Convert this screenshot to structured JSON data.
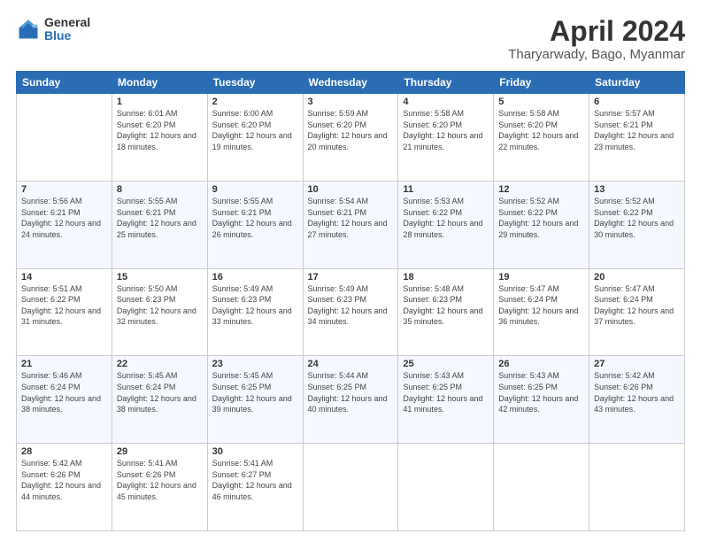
{
  "logo": {
    "general": "General",
    "blue": "Blue"
  },
  "title": "April 2024",
  "subtitle": "Tharyarwady, Bago, Myanmar",
  "headers": [
    "Sunday",
    "Monday",
    "Tuesday",
    "Wednesday",
    "Thursday",
    "Friday",
    "Saturday"
  ],
  "weeks": [
    [
      {
        "day": "",
        "sunrise": "",
        "sunset": "",
        "daylight": ""
      },
      {
        "day": "1",
        "sunrise": "Sunrise: 6:01 AM",
        "sunset": "Sunset: 6:20 PM",
        "daylight": "Daylight: 12 hours and 18 minutes."
      },
      {
        "day": "2",
        "sunrise": "Sunrise: 6:00 AM",
        "sunset": "Sunset: 6:20 PM",
        "daylight": "Daylight: 12 hours and 19 minutes."
      },
      {
        "day": "3",
        "sunrise": "Sunrise: 5:59 AM",
        "sunset": "Sunset: 6:20 PM",
        "daylight": "Daylight: 12 hours and 20 minutes."
      },
      {
        "day": "4",
        "sunrise": "Sunrise: 5:58 AM",
        "sunset": "Sunset: 6:20 PM",
        "daylight": "Daylight: 12 hours and 21 minutes."
      },
      {
        "day": "5",
        "sunrise": "Sunrise: 5:58 AM",
        "sunset": "Sunset: 6:20 PM",
        "daylight": "Daylight: 12 hours and 22 minutes."
      },
      {
        "day": "6",
        "sunrise": "Sunrise: 5:57 AM",
        "sunset": "Sunset: 6:21 PM",
        "daylight": "Daylight: 12 hours and 23 minutes."
      }
    ],
    [
      {
        "day": "7",
        "sunrise": "Sunrise: 5:56 AM",
        "sunset": "Sunset: 6:21 PM",
        "daylight": "Daylight: 12 hours and 24 minutes."
      },
      {
        "day": "8",
        "sunrise": "Sunrise: 5:55 AM",
        "sunset": "Sunset: 6:21 PM",
        "daylight": "Daylight: 12 hours and 25 minutes."
      },
      {
        "day": "9",
        "sunrise": "Sunrise: 5:55 AM",
        "sunset": "Sunset: 6:21 PM",
        "daylight": "Daylight: 12 hours and 26 minutes."
      },
      {
        "day": "10",
        "sunrise": "Sunrise: 5:54 AM",
        "sunset": "Sunset: 6:21 PM",
        "daylight": "Daylight: 12 hours and 27 minutes."
      },
      {
        "day": "11",
        "sunrise": "Sunrise: 5:53 AM",
        "sunset": "Sunset: 6:22 PM",
        "daylight": "Daylight: 12 hours and 28 minutes."
      },
      {
        "day": "12",
        "sunrise": "Sunrise: 5:52 AM",
        "sunset": "Sunset: 6:22 PM",
        "daylight": "Daylight: 12 hours and 29 minutes."
      },
      {
        "day": "13",
        "sunrise": "Sunrise: 5:52 AM",
        "sunset": "Sunset: 6:22 PM",
        "daylight": "Daylight: 12 hours and 30 minutes."
      }
    ],
    [
      {
        "day": "14",
        "sunrise": "Sunrise: 5:51 AM",
        "sunset": "Sunset: 6:22 PM",
        "daylight": "Daylight: 12 hours and 31 minutes."
      },
      {
        "day": "15",
        "sunrise": "Sunrise: 5:50 AM",
        "sunset": "Sunset: 6:23 PM",
        "daylight": "Daylight: 12 hours and 32 minutes."
      },
      {
        "day": "16",
        "sunrise": "Sunrise: 5:49 AM",
        "sunset": "Sunset: 6:23 PM",
        "daylight": "Daylight: 12 hours and 33 minutes."
      },
      {
        "day": "17",
        "sunrise": "Sunrise: 5:49 AM",
        "sunset": "Sunset: 6:23 PM",
        "daylight": "Daylight: 12 hours and 34 minutes."
      },
      {
        "day": "18",
        "sunrise": "Sunrise: 5:48 AM",
        "sunset": "Sunset: 6:23 PM",
        "daylight": "Daylight: 12 hours and 35 minutes."
      },
      {
        "day": "19",
        "sunrise": "Sunrise: 5:47 AM",
        "sunset": "Sunset: 6:24 PM",
        "daylight": "Daylight: 12 hours and 36 minutes."
      },
      {
        "day": "20",
        "sunrise": "Sunrise: 5:47 AM",
        "sunset": "Sunset: 6:24 PM",
        "daylight": "Daylight: 12 hours and 37 minutes."
      }
    ],
    [
      {
        "day": "21",
        "sunrise": "Sunrise: 5:46 AM",
        "sunset": "Sunset: 6:24 PM",
        "daylight": "Daylight: 12 hours and 38 minutes."
      },
      {
        "day": "22",
        "sunrise": "Sunrise: 5:45 AM",
        "sunset": "Sunset: 6:24 PM",
        "daylight": "Daylight: 12 hours and 38 minutes."
      },
      {
        "day": "23",
        "sunrise": "Sunrise: 5:45 AM",
        "sunset": "Sunset: 6:25 PM",
        "daylight": "Daylight: 12 hours and 39 minutes."
      },
      {
        "day": "24",
        "sunrise": "Sunrise: 5:44 AM",
        "sunset": "Sunset: 6:25 PM",
        "daylight": "Daylight: 12 hours and 40 minutes."
      },
      {
        "day": "25",
        "sunrise": "Sunrise: 5:43 AM",
        "sunset": "Sunset: 6:25 PM",
        "daylight": "Daylight: 12 hours and 41 minutes."
      },
      {
        "day": "26",
        "sunrise": "Sunrise: 5:43 AM",
        "sunset": "Sunset: 6:25 PM",
        "daylight": "Daylight: 12 hours and 42 minutes."
      },
      {
        "day": "27",
        "sunrise": "Sunrise: 5:42 AM",
        "sunset": "Sunset: 6:26 PM",
        "daylight": "Daylight: 12 hours and 43 minutes."
      }
    ],
    [
      {
        "day": "28",
        "sunrise": "Sunrise: 5:42 AM",
        "sunset": "Sunset: 6:26 PM",
        "daylight": "Daylight: 12 hours and 44 minutes."
      },
      {
        "day": "29",
        "sunrise": "Sunrise: 5:41 AM",
        "sunset": "Sunset: 6:26 PM",
        "daylight": "Daylight: 12 hours and 45 minutes."
      },
      {
        "day": "30",
        "sunrise": "Sunrise: 5:41 AM",
        "sunset": "Sunset: 6:27 PM",
        "daylight": "Daylight: 12 hours and 46 minutes."
      },
      {
        "day": "",
        "sunrise": "",
        "sunset": "",
        "daylight": ""
      },
      {
        "day": "",
        "sunrise": "",
        "sunset": "",
        "daylight": ""
      },
      {
        "day": "",
        "sunrise": "",
        "sunset": "",
        "daylight": ""
      },
      {
        "day": "",
        "sunrise": "",
        "sunset": "",
        "daylight": ""
      }
    ]
  ]
}
